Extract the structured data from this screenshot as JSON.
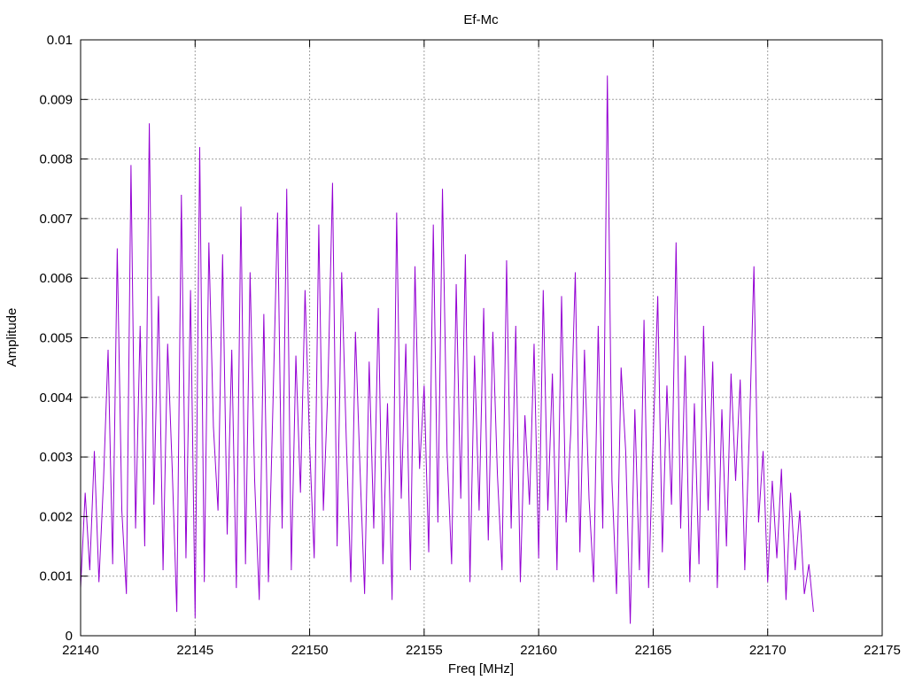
{
  "chart_data": {
    "type": "line",
    "title": "Ef-Mc",
    "xlabel": "Freq [MHz]",
    "ylabel": "Amplitude",
    "xlim": [
      22140,
      22175
    ],
    "ylim": [
      0,
      0.01
    ],
    "xticks": [
      22140,
      22145,
      22150,
      22155,
      22160,
      22165,
      22170,
      22175
    ],
    "yticks": [
      0,
      0.001,
      0.002,
      0.003,
      0.004,
      0.005,
      0.006,
      0.007,
      0.008,
      0.009,
      0.01
    ],
    "xtick_labels": [
      "22140",
      "22145",
      "22150",
      "22155",
      "22160",
      "22165",
      "22170",
      "22175"
    ],
    "ytick_labels": [
      "0",
      "0.001",
      "0.002",
      "0.003",
      "0.004",
      "0.005",
      "0.006",
      "0.007",
      "0.008",
      "0.009",
      "0.01"
    ],
    "grid": true,
    "line_color": "#9400d3",
    "series": [
      {
        "x": [
          22140.0,
          22140.2,
          22140.4,
          22140.6,
          22140.8,
          22141.0,
          22141.2,
          22141.4,
          22141.6,
          22141.8,
          22142.0,
          22142.2,
          22142.4,
          22142.6,
          22142.8,
          22143.0,
          22143.2,
          22143.4,
          22143.6,
          22143.8,
          22144.0,
          22144.2,
          22144.4,
          22144.6,
          22144.8,
          22145.0,
          22145.2,
          22145.4,
          22145.6,
          22145.8,
          22146.0,
          22146.2,
          22146.4,
          22146.6,
          22146.8,
          22147.0,
          22147.2,
          22147.4,
          22147.6,
          22147.8,
          22148.0,
          22148.2,
          22148.4,
          22148.6,
          22148.8,
          22149.0,
          22149.2,
          22149.4,
          22149.6,
          22149.8,
          22150.0,
          22150.2,
          22150.4,
          22150.6,
          22150.8,
          22151.0,
          22151.2,
          22151.4,
          22151.6,
          22151.8,
          22152.0,
          22152.2,
          22152.4,
          22152.6,
          22152.8,
          22153.0,
          22153.2,
          22153.4,
          22153.6,
          22153.8,
          22154.0,
          22154.2,
          22154.4,
          22154.6,
          22154.8,
          22155.0,
          22155.2,
          22155.4,
          22155.6,
          22155.8,
          22156.0,
          22156.2,
          22156.4,
          22156.6,
          22156.8,
          22157.0,
          22157.2,
          22157.4,
          22157.6,
          22157.8,
          22158.0,
          22158.2,
          22158.4,
          22158.6,
          22158.8,
          22159.0,
          22159.2,
          22159.4,
          22159.6,
          22159.8,
          22160.0,
          22160.2,
          22160.4,
          22160.6,
          22160.8,
          22161.0,
          22161.2,
          22161.4,
          22161.6,
          22161.8,
          22162.0,
          22162.2,
          22162.4,
          22162.6,
          22162.8,
          22163.0,
          22163.2,
          22163.4,
          22163.6,
          22163.8,
          22164.0,
          22164.2,
          22164.4,
          22164.6,
          22164.8,
          22165.0,
          22165.2,
          22165.4,
          22165.6,
          22165.8,
          22166.0,
          22166.2,
          22166.4,
          22166.6,
          22166.8,
          22167.0,
          22167.2,
          22167.4,
          22167.6,
          22167.8,
          22168.0,
          22168.2,
          22168.4,
          22168.6,
          22168.8,
          22169.0,
          22169.2,
          22169.4,
          22169.6,
          22169.8,
          22170.0,
          22170.2,
          22170.4,
          22170.6,
          22170.8,
          22171.0,
          22171.2,
          22171.4,
          22171.6,
          22171.8,
          22172.0
        ],
        "y": [
          0.0008,
          0.0024,
          0.0011,
          0.0031,
          0.0009,
          0.0026,
          0.0048,
          0.0012,
          0.0065,
          0.0021,
          0.0007,
          0.0079,
          0.0018,
          0.0052,
          0.0015,
          0.0086,
          0.0022,
          0.0057,
          0.0011,
          0.0049,
          0.0028,
          0.0004,
          0.0074,
          0.0013,
          0.0058,
          0.0003,
          0.0082,
          0.0009,
          0.0066,
          0.0035,
          0.0021,
          0.0064,
          0.0017,
          0.0048,
          0.0008,
          0.0072,
          0.0012,
          0.0061,
          0.0026,
          0.0006,
          0.0054,
          0.0009,
          0.0039,
          0.0071,
          0.0018,
          0.0075,
          0.0011,
          0.0047,
          0.0024,
          0.0058,
          0.0032,
          0.0013,
          0.0069,
          0.0021,
          0.0042,
          0.0076,
          0.0015,
          0.0061,
          0.0033,
          0.0009,
          0.0051,
          0.0028,
          0.0007,
          0.0046,
          0.0018,
          0.0055,
          0.0012,
          0.0039,
          0.0006,
          0.0071,
          0.0023,
          0.0049,
          0.0011,
          0.0062,
          0.0028,
          0.0042,
          0.0014,
          0.0069,
          0.0019,
          0.0075,
          0.0031,
          0.0012,
          0.0059,
          0.0023,
          0.0064,
          0.0009,
          0.0047,
          0.0021,
          0.0055,
          0.0016,
          0.0051,
          0.0027,
          0.0011,
          0.0063,
          0.0018,
          0.0052,
          0.0009,
          0.0037,
          0.0022,
          0.0049,
          0.0013,
          0.0058,
          0.0021,
          0.0044,
          0.0011,
          0.0057,
          0.0019,
          0.0034,
          0.0061,
          0.0014,
          0.0048,
          0.0023,
          0.0009,
          0.0052,
          0.0018,
          0.0094,
          0.0026,
          0.0007,
          0.0045,
          0.0031,
          0.0002,
          0.0038,
          0.0011,
          0.0053,
          0.0008,
          0.0033,
          0.0057,
          0.0014,
          0.0042,
          0.0022,
          0.0066,
          0.0018,
          0.0047,
          0.0009,
          0.0039,
          0.0012,
          0.0052,
          0.0021,
          0.0046,
          0.0008,
          0.0038,
          0.0015,
          0.0044,
          0.0026,
          0.0043,
          0.0011,
          0.0034,
          0.0062,
          0.0019,
          0.0031,
          0.0009,
          0.0026,
          0.0013,
          0.0028,
          0.0006,
          0.0024,
          0.0011,
          0.0021,
          0.0007,
          0.0012,
          0.0004
        ]
      }
    ]
  }
}
